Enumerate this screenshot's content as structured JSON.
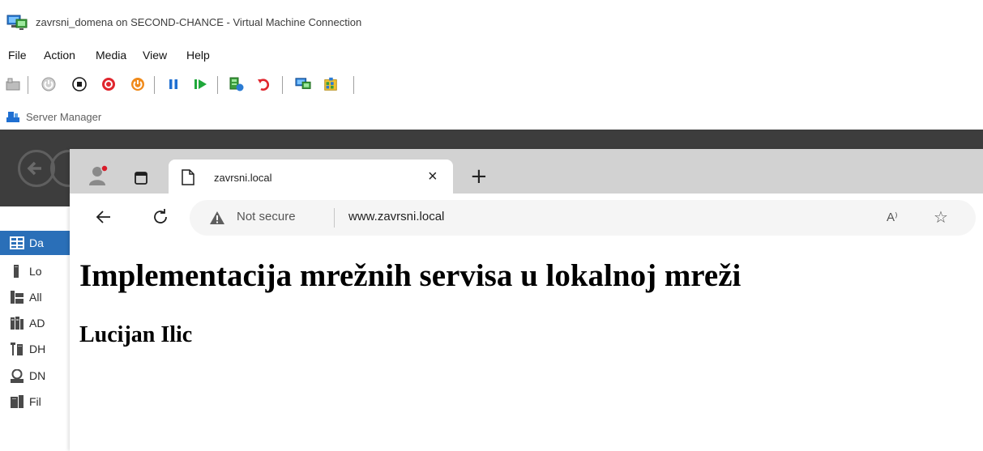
{
  "vm_window": {
    "title": "zavrsni_domena on SECOND-CHANCE - Virtual Machine Connection",
    "menu": [
      "File",
      "Action",
      "Media",
      "View",
      "Help"
    ],
    "toolbar_icons": [
      "ctrl-alt-del-icon",
      "start-icon",
      "turn-off-icon",
      "shut-down-icon",
      "save-icon",
      "pause-icon",
      "resume-icon",
      "checkpoint-icon",
      "revert-icon",
      "enhanced-session-icon",
      "share-icon"
    ]
  },
  "server_manager": {
    "title": "Server Manager",
    "sidebar": [
      {
        "label": "Da",
        "icon": "dashboard-icon",
        "active": true
      },
      {
        "label": "Lo",
        "icon": "local-server-icon",
        "active": false
      },
      {
        "label": "All",
        "icon": "all-servers-icon",
        "active": false
      },
      {
        "label": "AD",
        "icon": "ad-ds-icon",
        "active": false
      },
      {
        "label": "DH",
        "icon": "dhcp-icon",
        "active": false
      },
      {
        "label": "DN",
        "icon": "dns-icon",
        "active": false
      },
      {
        "label": "Fil",
        "icon": "file-services-icon",
        "active": false
      }
    ]
  },
  "browser": {
    "tab_title": "zavrsni.local",
    "tab_close": "×",
    "new_tab": "+",
    "security_label": "Not secure",
    "url": "www.zavrsni.local",
    "read_aloud": "A⁾",
    "favorite": "☆"
  },
  "page": {
    "heading": "Implementacija mrežnih servisa u lokalnoj mreži",
    "subheading": "Lucijan Ilic"
  },
  "colors": {
    "accent": "#2a6fb8",
    "server_manager_dark": "#3d3d3d",
    "tabstrip": "#d2d2d2",
    "omnibox": "#f5f5f5"
  }
}
